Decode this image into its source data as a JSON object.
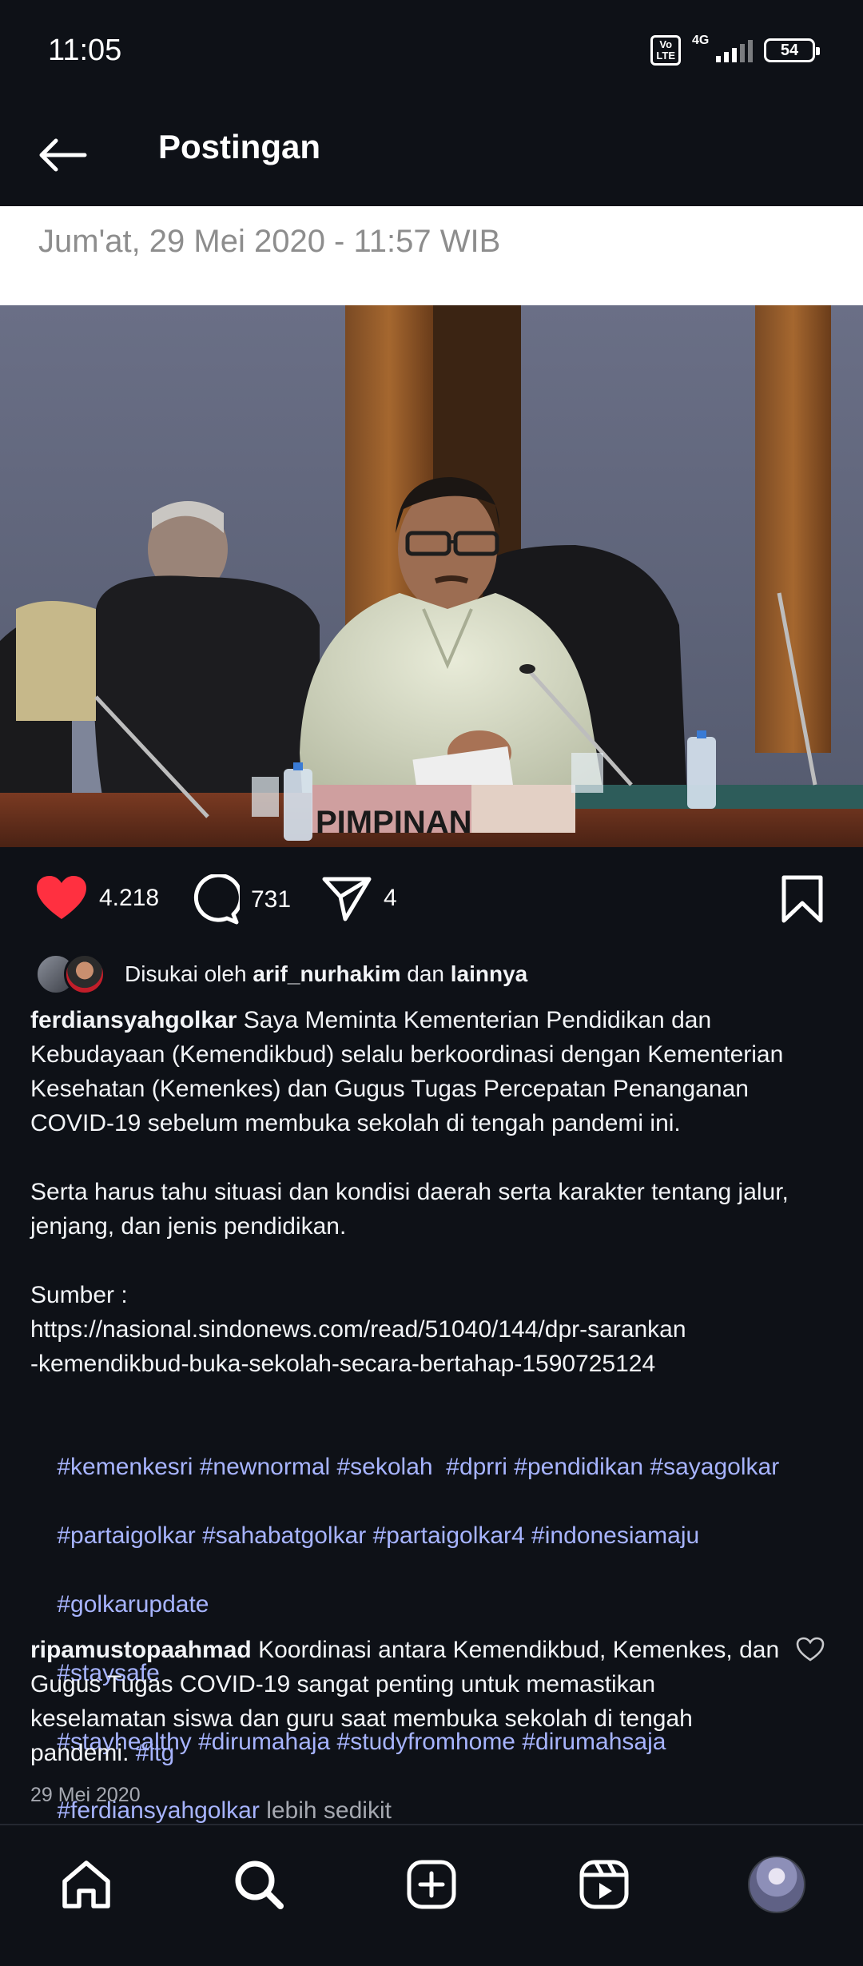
{
  "status_bar": {
    "time": "11:05",
    "volte": "Vo LTE",
    "network": "4G",
    "battery": "54"
  },
  "header": {
    "title": "Postingan",
    "back_icon": "arrow-left-icon"
  },
  "post": {
    "date_line": "Jum'at, 29 Mei 2020 - 11:57 WIB",
    "photo_sign_text": "PIMPINAN",
    "actions": {
      "likes": "4.218",
      "comments": "731",
      "shares": "4"
    },
    "liked_by": {
      "prefix": "Disukai oleh",
      "user": "arif_nurhakim",
      "connector": "dan",
      "suffix": "lainnya"
    },
    "caption": {
      "username": "ferdiansyahgolkar",
      "paragraph1": "Saya Meminta Kementerian Pendidikan dan Kebudayaan (Kemendikbud) selalu berkoordinasi dengan Kementerian Kesehatan (Kemenkes) dan Gugus Tugas Percepatan Penanganan COVID-19 sebelum membuka sekolah di tengah pandemi ini.",
      "paragraph2": "Serta harus tahu situasi dan kondisi daerah serta karakter tentang jalur, jenjang, dan jenis pendidikan.",
      "source_label": "Sumber :",
      "source_url_line1": "https://nasional.sindonews.com/read/51040/144/dpr-sarankan",
      "source_url_line2": "-kemendikbud-buka-sekolah-secara-bertahap-1590725124",
      "hashtags_line1": "#kemenkesri #newnormal #sekolah  #dprri #pendidikan #sayagolkar",
      "hashtags_line2": "#partaigolkar #sahabatgolkar #partaigolkar4 #indonesiamaju",
      "hashtags_line3": "#golkarupdate",
      "hashtags_line4": "#staysafe",
      "hashtags_line5": "#stayhealthy #dirumahaja #studyfromhome #dirumahsaja",
      "hashtags_line6": "#ferdiansyahgolkar",
      "less_label": "lebih sedikit"
    },
    "comment": {
      "username": "ripamustopaahmad",
      "text": "Koordinasi antara Kemendikbud, Kemenkes, dan Gugus Tugas COVID-19 sangat penting untuk memastikan keselamatan siswa dan guru saat membuka sekolah di tengah pandemi.",
      "tag": "#itg"
    },
    "timestamp": "29 Mei 2020"
  },
  "bottom_nav": {
    "items": [
      "home-icon",
      "search-icon",
      "create-post-icon",
      "reels-icon",
      "profile-avatar"
    ]
  },
  "colors": {
    "background": "#0e1117",
    "like_red": "#ff3040",
    "hashtag_blue": "#a7b4ff",
    "muted": "#a5a8b0"
  }
}
